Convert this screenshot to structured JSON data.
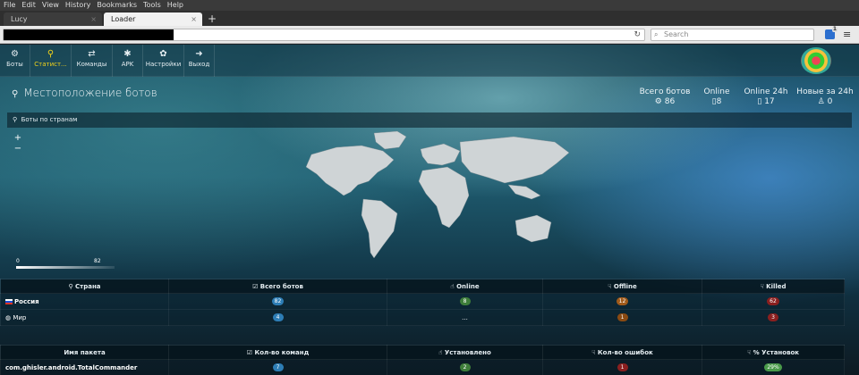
{
  "browser": {
    "menu": [
      "File",
      "Edit",
      "View",
      "History",
      "Bookmarks",
      "Tools",
      "Help"
    ],
    "tabs": [
      {
        "label": "Lucy",
        "active": false
      },
      {
        "label": "Loader",
        "active": true
      }
    ],
    "new_tab": "+",
    "search_placeholder": "Search",
    "extension_badge": "1"
  },
  "nav": {
    "items": [
      {
        "label": "Боты",
        "icon": "android-icon",
        "glyph": "⚙"
      },
      {
        "label": "Статист...",
        "icon": "map-pin-icon",
        "glyph": "⚲",
        "active": true
      },
      {
        "label": "Команды",
        "icon": "swap-arrows-icon",
        "glyph": "⇄"
      },
      {
        "label": "APK",
        "icon": "bug-icon",
        "glyph": "✱"
      },
      {
        "label": "Настройки",
        "icon": "cogs-icon",
        "glyph": "✿"
      },
      {
        "label": "Выход",
        "icon": "sign-out-icon",
        "glyph": "➜"
      }
    ]
  },
  "page": {
    "title": "Местоположение ботов",
    "stats": [
      {
        "label": "Всего ботов",
        "value": "86",
        "icon": "android-icon",
        "glyph": "⚙"
      },
      {
        "label": "Online",
        "value": "8",
        "icon": "phone-icon",
        "glyph": "▯"
      },
      {
        "label": "Online 24h",
        "value": "17",
        "icon": "phone-icon",
        "glyph": "▯"
      },
      {
        "label": "Новые за 24h",
        "value": "0",
        "icon": "user-icon",
        "glyph": "♙"
      }
    ]
  },
  "map_panel": {
    "title": "Боты по странам",
    "zoom_in": "+",
    "zoom_out": "−",
    "legend_min": "0",
    "legend_max": "82"
  },
  "countries_table": {
    "headers": [
      "Страна",
      "Всего ботов",
      "Online",
      "Offline",
      "Killed"
    ],
    "rows": [
      {
        "name": "Россия",
        "total": "82",
        "online": "8",
        "offline": "12",
        "killed": "62"
      },
      {
        "name": "Мир",
        "total": "4",
        "online": "...",
        "offline": "1",
        "killed": "3"
      }
    ]
  },
  "packages_table": {
    "headers": [
      "Имя пакета",
      "Кол-во команд",
      "Установлено",
      "Кол-во ошибок",
      "% Установок"
    ],
    "rows": [
      {
        "name": "com.ghisler.android.TotalCommander",
        "commands": "7",
        "installed": "2",
        "errors": "1",
        "percent": "29%"
      }
    ]
  },
  "colors": {
    "accent_active": "#f1d21a",
    "badge_blue": "#2d7db5",
    "badge_green": "#3e7d3a",
    "badge_red": "#8a1f1f"
  }
}
